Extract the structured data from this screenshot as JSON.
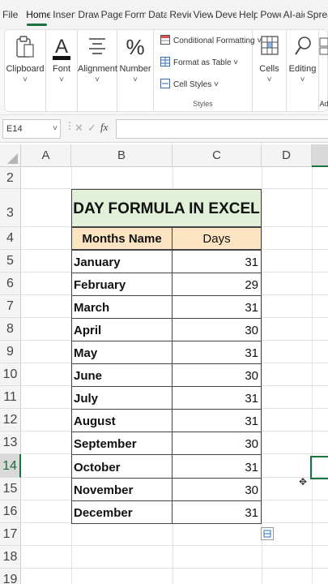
{
  "ribbon_tabs": [
    {
      "label": "File"
    },
    {
      "label": "Home"
    },
    {
      "label": "Insert"
    },
    {
      "label": "Draw"
    },
    {
      "label": "Page"
    },
    {
      "label": "Formulas"
    },
    {
      "label": "Data"
    },
    {
      "label": "Review"
    },
    {
      "label": "View"
    },
    {
      "label": "Developer"
    },
    {
      "label": "Help"
    },
    {
      "label": "Power"
    },
    {
      "label": "AI-aided"
    },
    {
      "label": "Spreadsheet"
    }
  ],
  "active_tab": "Home",
  "ribbon": {
    "clipboard": "Clipboard",
    "font": "Font",
    "alignment": "Alignment",
    "number": "Number",
    "conditional_formatting": "Conditional Formatting ˅",
    "format_as_table": "Format as Table ˅",
    "cell_styles": "Cell Styles ˅",
    "styles_group": "Styles",
    "cells": "Cells",
    "editing": "Editing",
    "add_ins": "Ad",
    "dropdown_caret": "˅"
  },
  "formula_bar": {
    "name_box": "E14",
    "name_caret": "˅",
    "dots": "⋮",
    "cancel": "✕",
    "enter": "✓",
    "fx": "fx",
    "value": ""
  },
  "columns": [
    "A",
    "B",
    "C",
    "D"
  ],
  "rows": [
    "2",
    "3",
    "4",
    "5",
    "6",
    "7",
    "8",
    "9",
    "10",
    "11",
    "12",
    "13",
    "14",
    "15",
    "16",
    "17",
    "18",
    "19"
  ],
  "selected_row": "14",
  "table": {
    "title": "DAY FORMULA IN EXCEL",
    "headers": [
      "Months Name",
      "Days"
    ],
    "data": [
      {
        "month": "January",
        "days": "31"
      },
      {
        "month": "February",
        "days": "29"
      },
      {
        "month": "March",
        "days": "31"
      },
      {
        "month": "April",
        "days": "30"
      },
      {
        "month": "May",
        "days": "31"
      },
      {
        "month": "June",
        "days": "30"
      },
      {
        "month": "July",
        "days": "31"
      },
      {
        "month": "August",
        "days": "31"
      },
      {
        "month": "September",
        "days": "30"
      },
      {
        "month": "October",
        "days": "31"
      },
      {
        "month": "November",
        "days": "30"
      },
      {
        "month": "December",
        "days": "31"
      }
    ]
  },
  "colors": {
    "accent": "#1a7340",
    "title_fill": "#e2efd9",
    "header_fill": "#fce4c2"
  }
}
